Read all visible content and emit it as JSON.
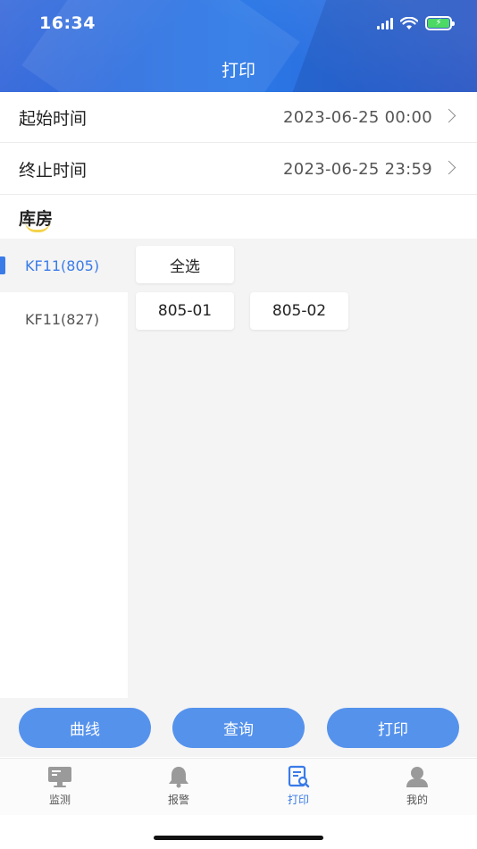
{
  "status_bar": {
    "time": "16:34"
  },
  "header": {
    "title": "打印"
  },
  "filters": {
    "start": {
      "label": "起始时间",
      "value": "2023-06-25 00:00"
    },
    "end": {
      "label": "终止时间",
      "value": "2023-06-25 23:59"
    }
  },
  "section": {
    "title": "库房"
  },
  "warehouses": [
    {
      "label": "KF11(805)",
      "active": true
    },
    {
      "label": "KF11(827)",
      "active": false
    }
  ],
  "rooms": {
    "select_all": "全选",
    "items": [
      "805-01",
      "805-02"
    ]
  },
  "actions": {
    "curve": "曲线",
    "query": "查询",
    "print": "打印"
  },
  "tabs": [
    {
      "label": "监测",
      "icon": "monitor-icon"
    },
    {
      "label": "报警",
      "icon": "bell-icon"
    },
    {
      "label": "打印",
      "icon": "print-doc-icon",
      "active": true
    },
    {
      "label": "我的",
      "icon": "user-icon"
    }
  ],
  "colors": {
    "accent": "#3a7be8",
    "button": "#5592ec",
    "header": "#2f6ade",
    "battery": "#4cd964"
  }
}
